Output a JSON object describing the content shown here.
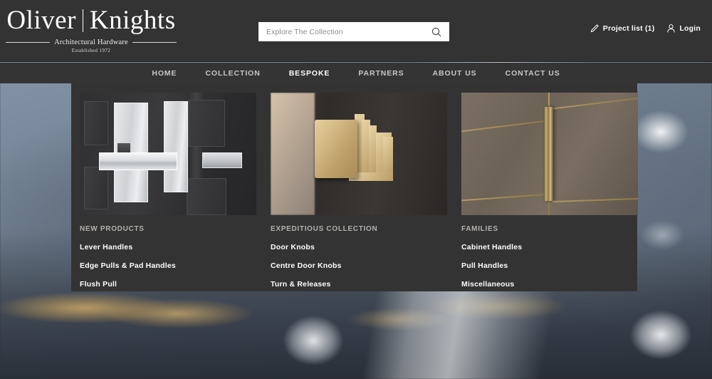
{
  "brand": {
    "name_left": "Oliver",
    "name_right": "Knights",
    "tagline": "Architectural Hardware",
    "established": "Established 1972"
  },
  "search": {
    "placeholder": "Explore The Collection",
    "value": "",
    "icon": "search-icon"
  },
  "header_right": {
    "project_list": {
      "label": "Project list (1)",
      "count": 1,
      "icon": "pencil-icon"
    },
    "login": {
      "label": "Login",
      "icon": "user-icon"
    }
  },
  "nav": {
    "items": [
      {
        "label": "HOME",
        "active": false
      },
      {
        "label": "COLLECTION",
        "active": false
      },
      {
        "label": "BESPOKE",
        "active": true
      },
      {
        "label": "PARTNERS",
        "active": false
      },
      {
        "label": "ABOUT US",
        "active": false
      },
      {
        "label": "CONTACT US",
        "active": false
      }
    ]
  },
  "dropdown": {
    "open": true,
    "parent": "BESPOKE",
    "columns": [
      {
        "image_alt": "Polished chrome lever handle on dark panelled door",
        "heading": "NEW PRODUCTS",
        "links": [
          "Lever Handles",
          "Edge Pulls & Pad Handles",
          "Flush Pull"
        ]
      },
      {
        "image_alt": "Satin brass stepped square door knob on dark wood door",
        "heading": "EXPEDITIOUS COLLECTION",
        "links": [
          "Door Knobs",
          "Centre Door Knobs",
          "Turn & Releases"
        ]
      },
      {
        "image_alt": "Antique bronze vertical pull handle on textured leather cabinet panels",
        "heading": "FAMILIES",
        "links": [
          "Cabinet Handles",
          "Pull Handles",
          "Miscellaneous"
        ]
      }
    ]
  },
  "hero": {
    "image_alt": "Blurred close-up of brass and polished chrome cabinet hardware on a blue-grey surface"
  },
  "colors": {
    "header_bg": "#333333",
    "nav_bg": "#343434",
    "dropdown_bg": "#333333",
    "dropdown_border": "#b9b9b9",
    "text_white": "#ffffff",
    "nav_inactive": "#c9c7c5",
    "heading_grey": "#b4b1ae",
    "search_bg": "#ffffff",
    "search_placeholder": "#8c8c8c"
  }
}
